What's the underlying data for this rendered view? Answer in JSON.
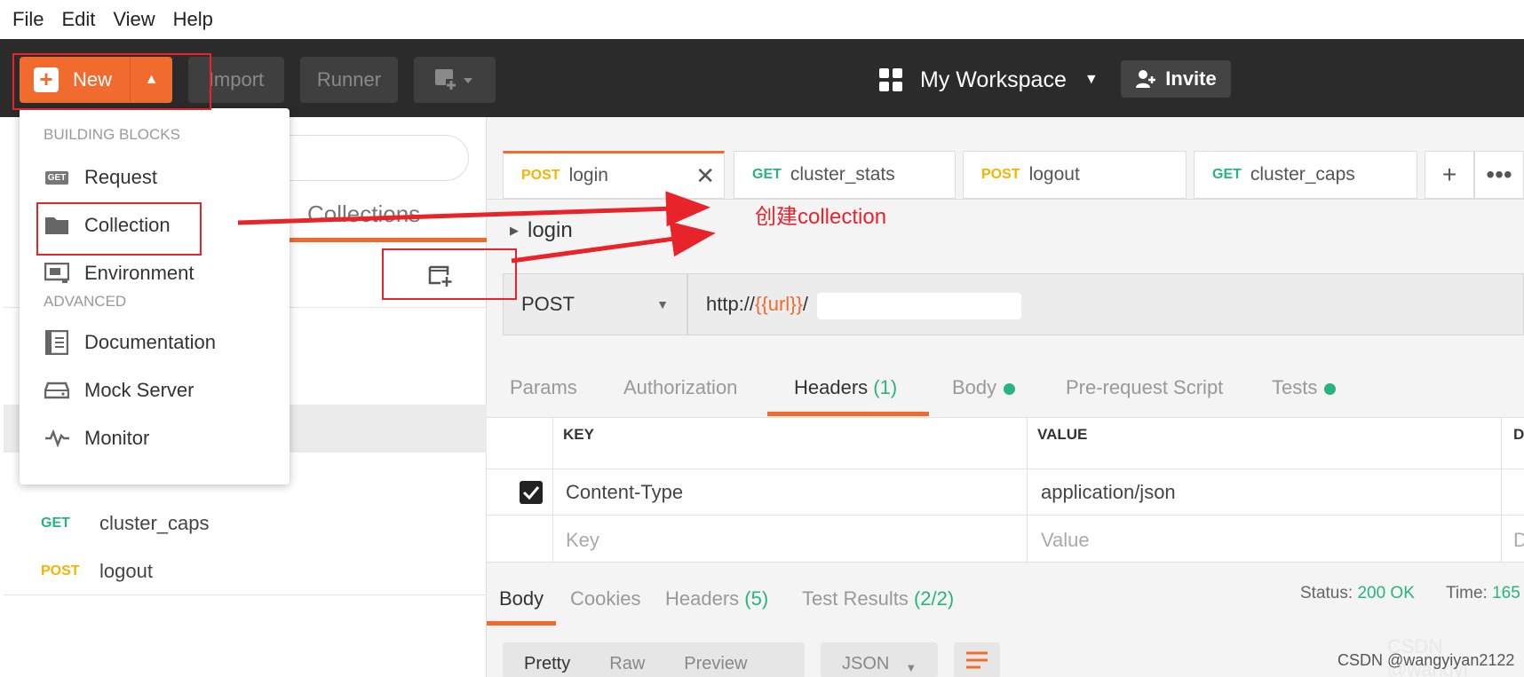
{
  "menubar": {
    "items": [
      "File",
      "Edit",
      "View",
      "Help"
    ]
  },
  "toolbar": {
    "new_label": "New",
    "import_label": "Import",
    "runner_label": "Runner",
    "workspace_label": "My Workspace",
    "invite_label": "Invite"
  },
  "new_menu": {
    "section_building": "BUILDING BLOCKS",
    "section_advanced": "ADVANCED",
    "request_badge": "GET",
    "items": {
      "request": "Request",
      "collection": "Collection",
      "environment": "Environment",
      "documentation": "Documentation",
      "mock_server": "Mock Server",
      "monitor": "Monitor"
    }
  },
  "sidebar": {
    "tab_collections": "Collections",
    "requests": [
      {
        "method": "GET",
        "name": "cluster_caps",
        "color": "#26b47f"
      },
      {
        "method": "POST",
        "name": "logout",
        "color": "#f4b400"
      }
    ]
  },
  "tabs": [
    {
      "method": "POST",
      "name": "login",
      "color": "#f4b400"
    },
    {
      "method": "GET",
      "name": "cluster_stats",
      "color": "#26b47f"
    },
    {
      "method": "POST",
      "name": "logout",
      "color": "#f4b400"
    },
    {
      "method": "GET",
      "name": "cluster_caps",
      "color": "#26b47f"
    }
  ],
  "request": {
    "breadcrumb": "login",
    "method": "POST",
    "url_prefix": "http://",
    "url_var": "{{url}}",
    "url_rest": "/"
  },
  "req_tabs": {
    "params": "Params",
    "authorization": "Authorization",
    "headers": "Headers",
    "headers_count": "(1)",
    "body": "Body",
    "prerequest": "Pre-request Script",
    "tests": "Tests"
  },
  "headers_table": {
    "col_key": "KEY",
    "col_value": "VALUE",
    "col_desc": "D",
    "rows": [
      {
        "key": "Content-Type",
        "value": "application/json",
        "checked": true
      }
    ],
    "placeholder_key": "Key",
    "placeholder_value": "Value",
    "placeholder_desc": "D"
  },
  "response": {
    "tab_body": "Body",
    "tab_cookies": "Cookies",
    "tab_headers": "Headers",
    "headers_count": "(5)",
    "tab_tests": "Test Results",
    "tests_count": "(2/2)",
    "status_label": "Status:",
    "status_value": "200 OK",
    "time_label": "Time:",
    "time_value": "165",
    "format_pretty": "Pretty",
    "format_raw": "Raw",
    "format_preview": "Preview",
    "format_lang": "JSON"
  },
  "annotation": {
    "text": "创建collection",
    "color": "#e8232a"
  },
  "watermark": {
    "csdn": "CSDN @wangyiyan2122",
    "faded": "CSDN @wangyi"
  },
  "colors": {
    "accent": "#f06b2d",
    "get": "#26b47f",
    "post": "#f4b400",
    "toolbar": "#2b2b2b"
  }
}
